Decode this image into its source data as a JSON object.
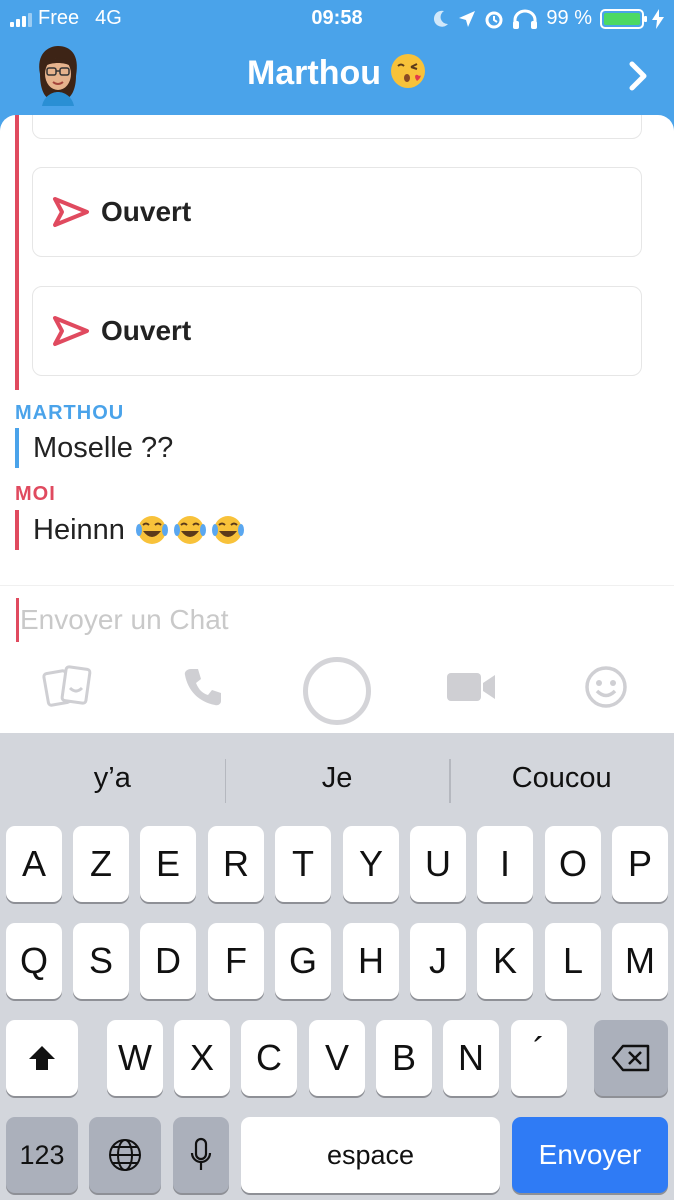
{
  "status_bar": {
    "carrier": "Free",
    "network": "4G",
    "time": "09:58",
    "battery": "99 %",
    "battery_level": 0.99,
    "icons": [
      "moon-icon",
      "location-arrow-icon",
      "alarm-icon",
      "headphones-icon",
      "battery-icon",
      "charging-bolt-icon"
    ]
  },
  "header": {
    "contact_name": "Marthou",
    "name_emoji": "face-blowing-kiss-emoji",
    "avatar_icon": "bitmoji-avatar-icon",
    "chevron_icon": "chevron-right-icon"
  },
  "chat": {
    "snaps": [
      {
        "label": "Ouvert",
        "icon": "sent-arrow-icon"
      },
      {
        "label": "Ouvert",
        "icon": "sent-arrow-icon"
      }
    ],
    "messages": [
      {
        "sender": "MARTHOU",
        "text": "Moselle ??"
      },
      {
        "sender": "MOI",
        "text": "Heinnn",
        "emojis": [
          "tears-of-joy-emoji",
          "tears-of-joy-emoji",
          "tears-of-joy-emoji"
        ]
      }
    ]
  },
  "composer": {
    "placeholder": "Envoyer un Chat",
    "value": ""
  },
  "toolbar": {
    "icons": [
      "memories-cards-icon",
      "phone-icon",
      "capture-button",
      "video-camera-icon",
      "smiley-icon"
    ]
  },
  "keyboard": {
    "suggestions": [
      "y’a",
      "Je",
      "Coucou"
    ],
    "row1": [
      "A",
      "Z",
      "E",
      "R",
      "T",
      "Y",
      "U",
      "I",
      "O",
      "P"
    ],
    "row2": [
      "Q",
      "S",
      "D",
      "F",
      "G",
      "H",
      "J",
      "K",
      "L",
      "M"
    ],
    "row3": [
      "W",
      "X",
      "C",
      "V",
      "B",
      "N",
      "´"
    ],
    "numbers_key": "123",
    "space_key": "espace",
    "send_key": "Envoyer",
    "colors": {
      "send": "#2f7bf5",
      "background": "#d3d6dc"
    }
  },
  "colors": {
    "header": "#4aa3ea",
    "them": "#4aa3ea",
    "me": "#e04a5f"
  }
}
